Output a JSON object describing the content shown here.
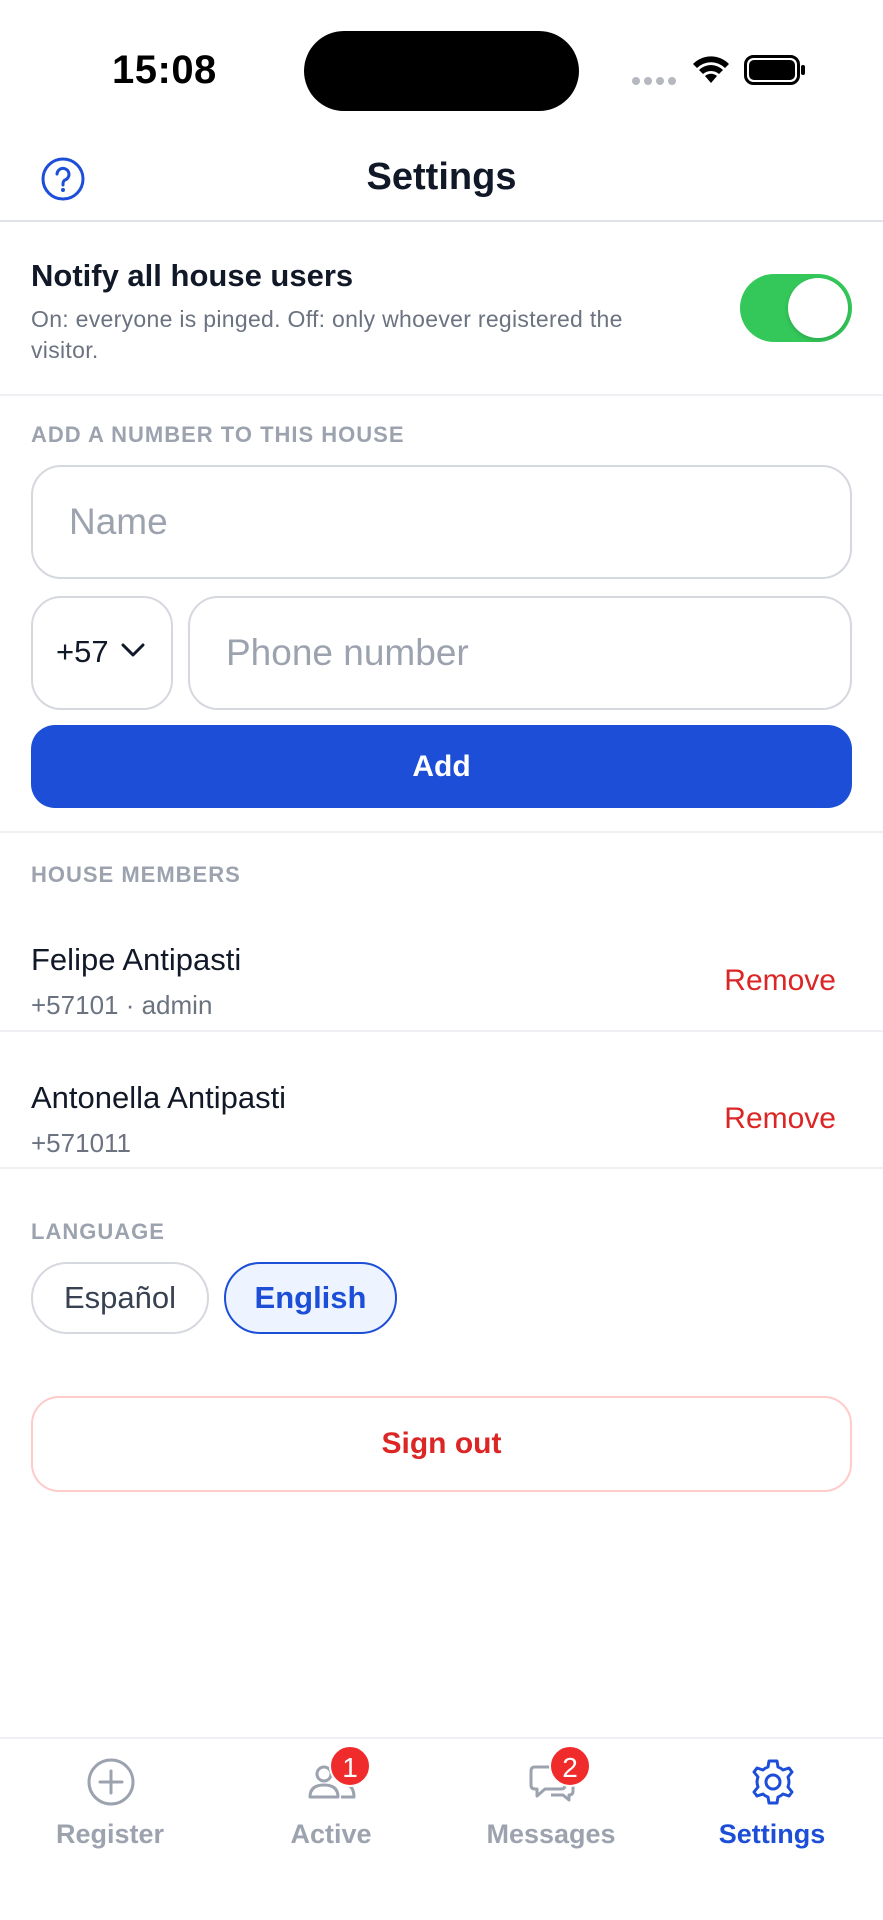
{
  "status_bar": {
    "time": "15:08"
  },
  "header": {
    "title": "Settings",
    "help_icon": "question-circle-icon"
  },
  "notify": {
    "title": "Notify all house users",
    "description": "On: everyone is pinged. Off: only whoever registered the visitor.",
    "enabled": true,
    "toggle_color": "#34c759"
  },
  "add_number": {
    "section_label": "ADD A NUMBER TO THIS HOUSE",
    "name_placeholder": "Name",
    "name_value": "",
    "country_code": "+57",
    "phone_placeholder": "Phone number",
    "phone_value": "",
    "add_label": "Add"
  },
  "members": {
    "section_label": "HOUSE MEMBERS",
    "items": [
      {
        "name": "Felipe Antipasti",
        "sub": "+57101 · admin",
        "remove_label": "Remove"
      },
      {
        "name": "Antonella Antipasti",
        "sub": "+571011",
        "remove_label": "Remove"
      }
    ]
  },
  "language": {
    "section_label": "LANGUAGE",
    "options": [
      {
        "label": "Español",
        "selected": false
      },
      {
        "label": "English",
        "selected": true
      }
    ]
  },
  "sign_out_label": "Sign out",
  "tabs": [
    {
      "label": "Register",
      "icon": "plus-circle-icon",
      "badge": null,
      "active": false
    },
    {
      "label": "Active",
      "icon": "users-icon",
      "badge": "1",
      "active": false
    },
    {
      "label": "Messages",
      "icon": "chat-bubbles-icon",
      "badge": "2",
      "active": false
    },
    {
      "label": "Settings",
      "icon": "gear-icon",
      "badge": null,
      "active": true
    }
  ],
  "colors": {
    "accent": "#1d4ed8",
    "danger": "#dc2626",
    "badge": "#ef2b2b"
  }
}
